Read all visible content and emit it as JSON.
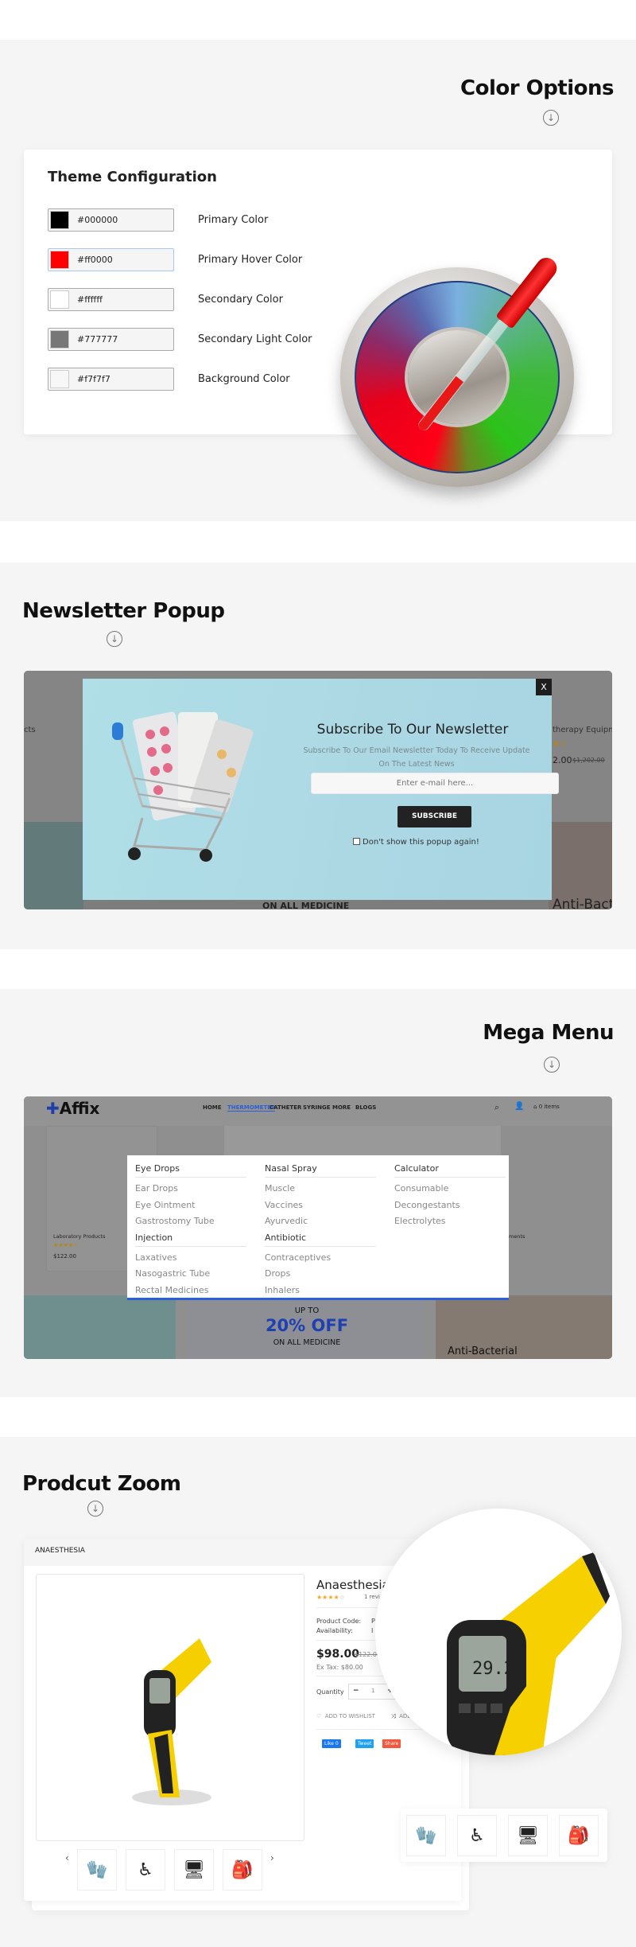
{
  "sections": {
    "color_options": {
      "title": "Color Options",
      "card_title": "Theme Configuration",
      "options": [
        {
          "hex": "#000000",
          "label": "Primary Color",
          "swatch": "#000000"
        },
        {
          "hex": "#ff0000",
          "label": "Primary Hover Color",
          "swatch": "#ff0000"
        },
        {
          "hex": "#ffffff",
          "label": "Secondary Color",
          "swatch": "#ffffff"
        },
        {
          "hex": "#777777",
          "label": "Secondary Light Color",
          "swatch": "#777777"
        },
        {
          "hex": "#f7f7f7",
          "label": "Background Color",
          "swatch": "#f7f7f7"
        }
      ]
    },
    "newsletter": {
      "title": "Newsletter Popup",
      "popup_title": "Subscribe To Our Newsletter",
      "popup_text": "Subscribe To Our Email Newsletter Today To Receive Update On The Latest News",
      "email_placeholder": "Enter e-mail here...",
      "subscribe": "SUBSCRIBE",
      "dont_show": "Don't show this popup again!",
      "close": "X",
      "bg_left": "cts",
      "bg_right_title": "therapy Equipm",
      "bg_price": "2.00",
      "bg_old_price": "$1,202.00",
      "bg_banner": "ON ALL MEDICINE",
      "bg_banner_right": "Anti-Bacte"
    },
    "mega_menu": {
      "title": "Mega Menu",
      "logo": "Affix",
      "nav": [
        "HOME",
        "THERMOMETER",
        "CATHETER",
        "SYRINGE",
        "MORE",
        "BLOGS"
      ],
      "active_nav": "THERMOMETER",
      "cart": "0 items",
      "columns": [
        {
          "groups": [
            {
              "heading": "Eye Drops",
              "items": [
                "Ear Drops",
                "Eye Ointment",
                "Gastrostomy Tube"
              ]
            },
            {
              "heading": "Injection",
              "items": [
                "Laxatives",
                "Nasogastric Tube",
                "Rectal Medicines"
              ]
            }
          ]
        },
        {
          "groups": [
            {
              "heading": "Nasal Spray",
              "items": [
                "Muscle",
                "Vaccines",
                "Ayurvedic"
              ]
            },
            {
              "heading": "Antibiotic",
              "items": [
                "Contraceptives",
                "Drops",
                "Inhalers"
              ]
            }
          ]
        },
        {
          "groups": [
            {
              "heading": "Calculator",
              "items": [
                "Consumable",
                "Decongestants",
                "Electrolytes"
              ]
            }
          ]
        }
      ],
      "bg_product": "Laboratory Products",
      "bg_price": "$122.00",
      "bg_right": "ments",
      "banner": {
        "line1": "UP TO",
        "line2": "20% OFF",
        "line3": "ON ALL MEDICINE",
        "right": "Anti-Bacterial"
      },
      "accent": "#2b5fd9"
    },
    "product_zoom": {
      "title": "Prodcut Zoom",
      "breadcrumb": "ANAESTHESIA",
      "name": "Anaesthesia",
      "rating": 4,
      "reviews": "1 revi",
      "code_label": "Product Code:",
      "code_value": "P",
      "availability_label": "Availability:",
      "availability_value": "I",
      "price": "$98.00",
      "old_price": "$122.00",
      "ex_tax": "Ex Tax: $80.00",
      "quantity_label": "Quantity",
      "quantity": "1",
      "wishlist": "ADD TO WISHLIST",
      "compare": "ADD",
      "social": [
        "Like 0",
        "Tweet",
        "Share"
      ],
      "thumbs": [
        "gloves",
        "wheelchair",
        "ultrasound-machine",
        "first-aid-bag"
      ],
      "lcd": "29.2"
    }
  }
}
